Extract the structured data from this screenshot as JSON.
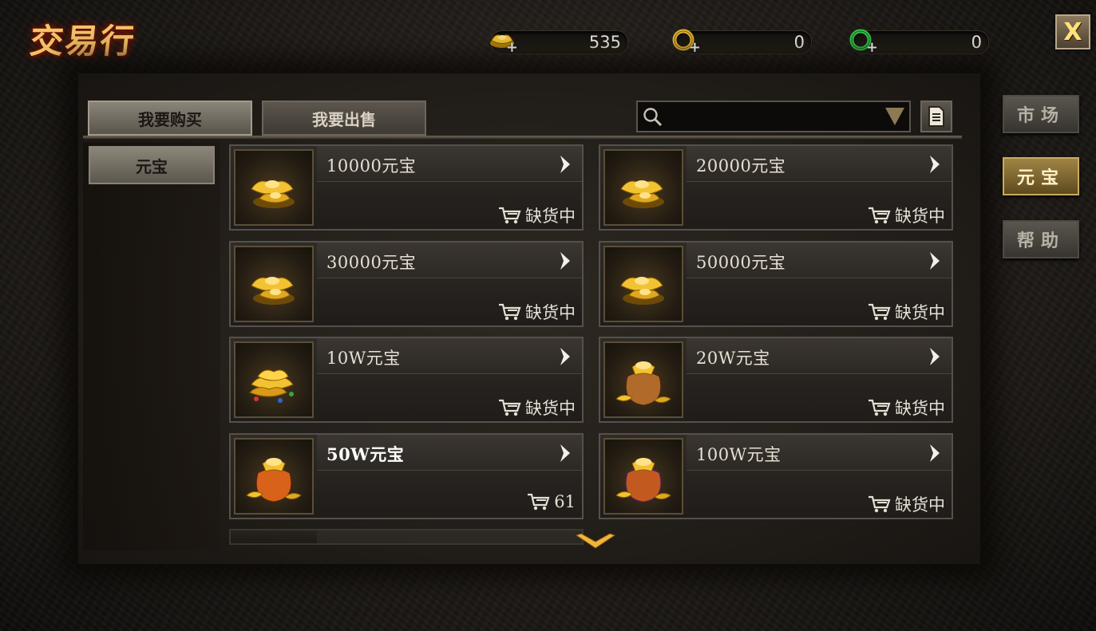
{
  "title": "交易行",
  "currencies": [
    {
      "name": "gold-ingot",
      "value": "535",
      "color": "#e8b82a"
    },
    {
      "name": "gold-coin",
      "value": "0",
      "color": "#d8b030"
    },
    {
      "name": "green-coin",
      "value": "0",
      "color": "#35c447"
    }
  ],
  "close_label": "X",
  "tabs": {
    "buy": "我要购买",
    "sell": "我要出售"
  },
  "search": {
    "placeholder": ""
  },
  "category": "元宝",
  "side_nav": {
    "market": "市场",
    "ingot": "元宝",
    "help": "帮助"
  },
  "items": [
    {
      "name": "10000元宝",
      "stock": "缺货中",
      "icon": "gold-ingots-icon"
    },
    {
      "name": "20000元宝",
      "stock": "缺货中",
      "icon": "gold-ingots-icon"
    },
    {
      "name": "30000元宝",
      "stock": "缺货中",
      "icon": "gold-ingots-icon"
    },
    {
      "name": "50000元宝",
      "stock": "缺货中",
      "icon": "gold-ingots-icon"
    },
    {
      "name": "10W元宝",
      "stock": "缺货中",
      "icon": "gold-ingot-pile-icon"
    },
    {
      "name": "20W元宝",
      "stock": "缺货中",
      "icon": "money-bag-icon"
    },
    {
      "name": "50W元宝",
      "stock": "61",
      "icon": "treasure-bag-icon"
    },
    {
      "name": "100W元宝",
      "stock": "缺货中",
      "icon": "jeweled-bag-icon"
    }
  ]
}
